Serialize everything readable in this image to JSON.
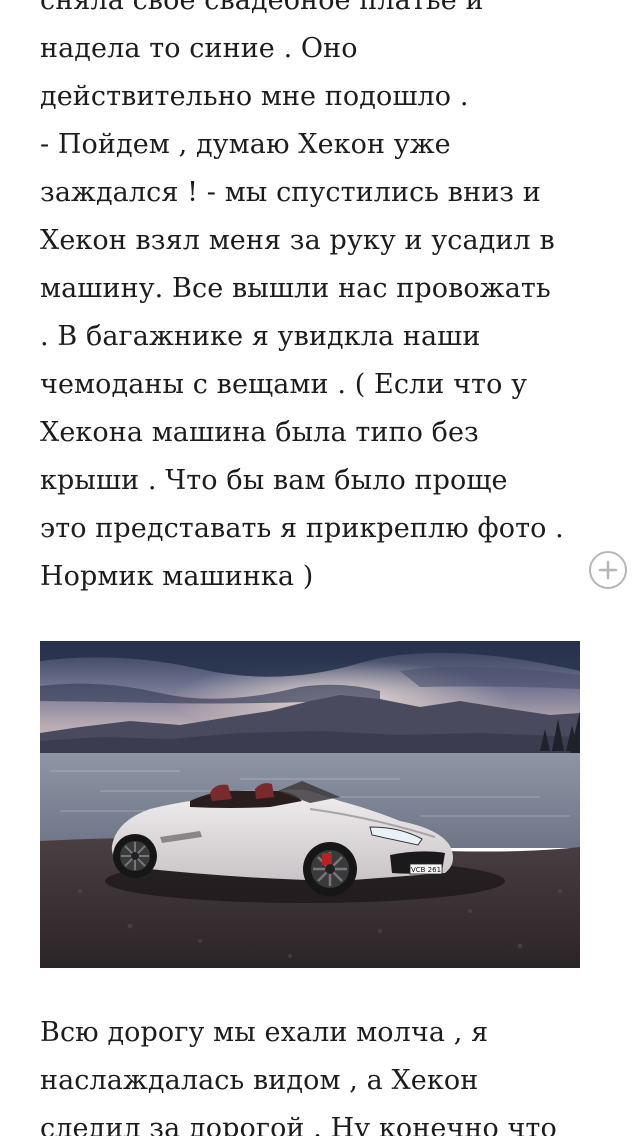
{
  "story": {
    "paragraph_top": [
      "сняла свое свадебное платье и",
      "надела то синие . Оно",
      "действительно мне подошло .",
      "- Пойдем , думаю Хекон уже",
      "заждался ! - мы спустились вниз и",
      "Хекон взял меня за руку и усадил в",
      "машину.  Все вышли нас провожать",
      ". В багажнике я увидкла наши",
      "чемоданы с вещами . ( Если что у",
      "Хекона машина была типо без",
      "крыши . Что бы вам было проще",
      "это представать я прикреплю фото .",
      "Нормик машинка )"
    ],
    "paragraph_bottom": [
      "Всю дорогу мы ехали молча , я",
      "наслаждалась видом , а Хекон",
      "следил за дорогой . Ну конечно что"
    ]
  },
  "photo": {
    "plate_text": "VCB 261",
    "subject": "white convertible car by a lake at dusk"
  },
  "icons": {
    "add_comment": "plus-circle-icon"
  },
  "colors": {
    "text": "#1c1c1c",
    "icon_gray": "#b6b6b6",
    "background": "#ffffff"
  }
}
